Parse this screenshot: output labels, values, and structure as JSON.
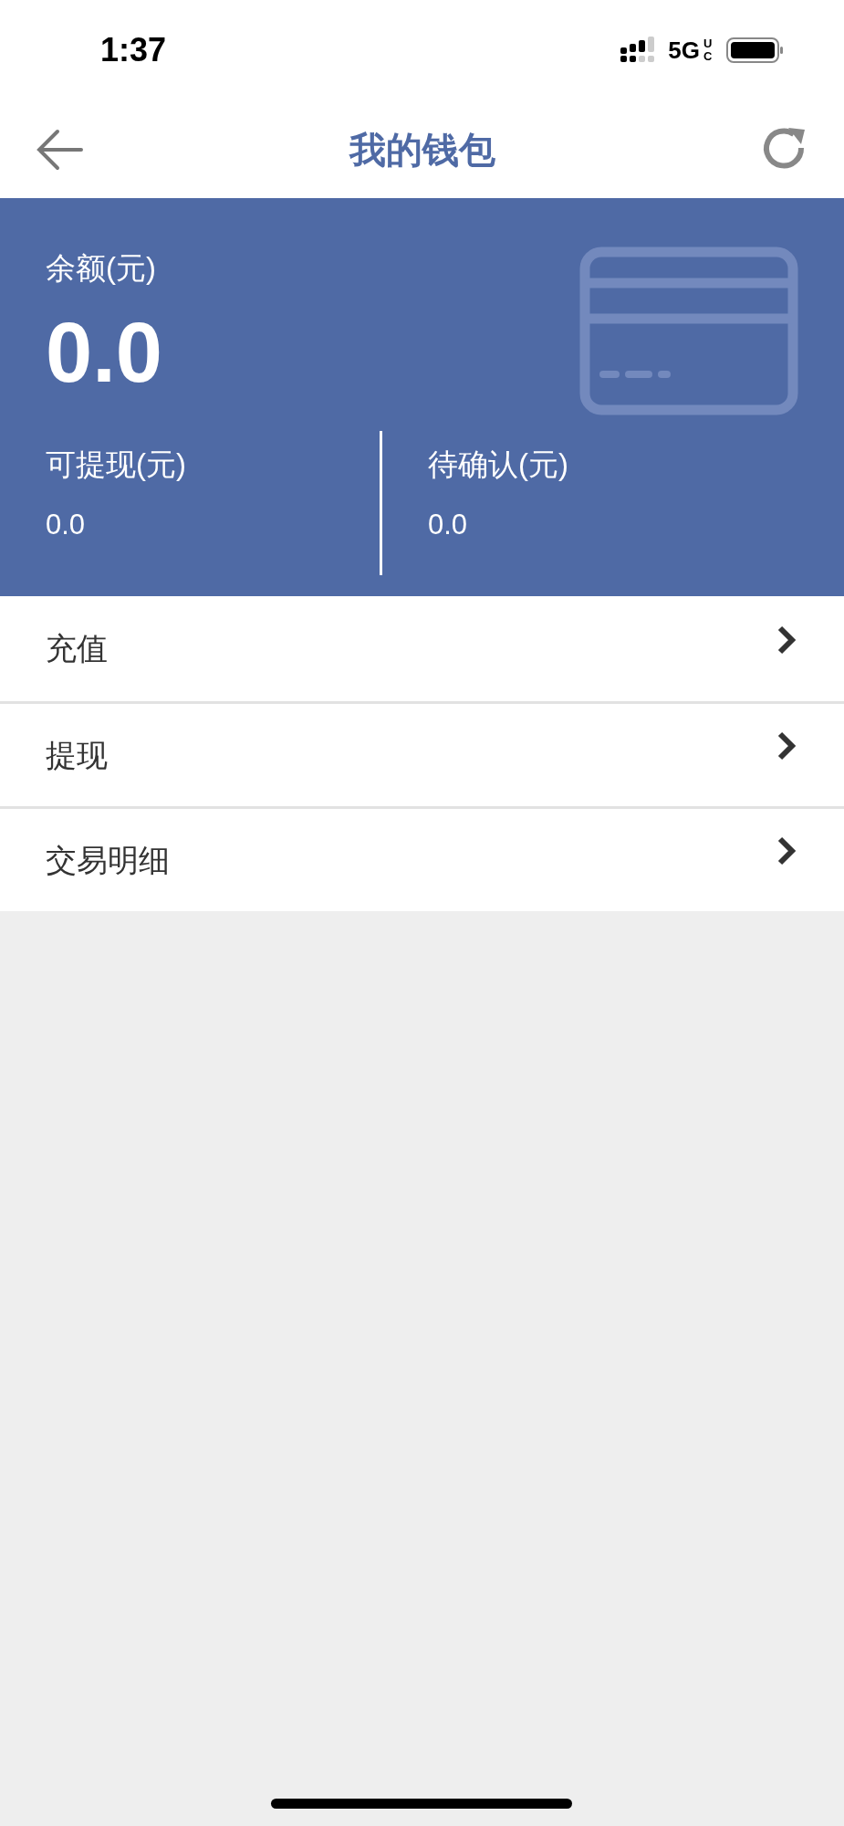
{
  "status_bar": {
    "time": "1:37",
    "network": "5G",
    "network_suffix": "UC"
  },
  "header": {
    "title": "我的钱包"
  },
  "balance": {
    "label": "余额(元)",
    "value": "0.0"
  },
  "sub_balances": [
    {
      "label": "可提现(元)",
      "value": "0.0"
    },
    {
      "label": "待确认(元)",
      "value": "0.0"
    }
  ],
  "menu": [
    {
      "label": "充值"
    },
    {
      "label": "提现"
    },
    {
      "label": "交易明细"
    }
  ]
}
